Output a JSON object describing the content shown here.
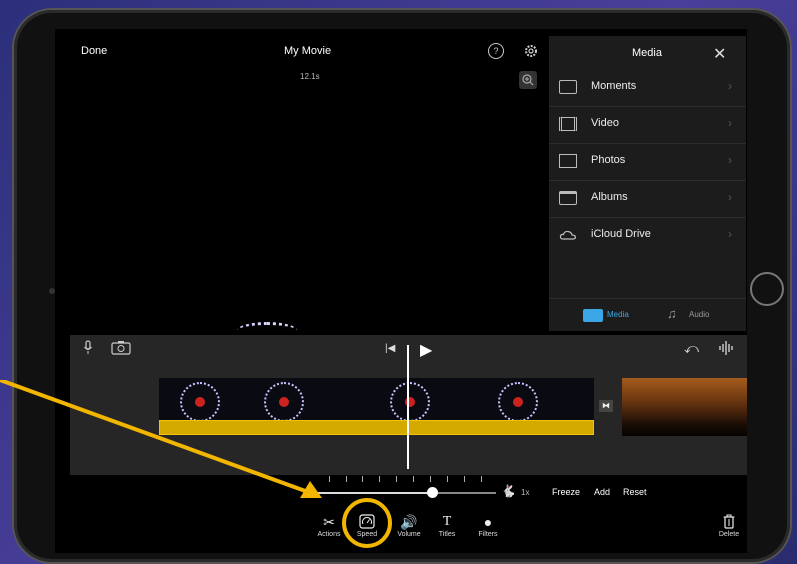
{
  "header": {
    "done_label": "Done",
    "title": "My Movie",
    "duration": "12.1s"
  },
  "icons": {
    "help": "help-icon",
    "settings": "gear-icon",
    "zoom": "zoom-in-icon"
  },
  "media_panel": {
    "title": "Media",
    "items": [
      {
        "label": "Moments",
        "icon": "moments-icon"
      },
      {
        "label": "Video",
        "icon": "film-icon"
      },
      {
        "label": "Photos",
        "icon": "photo-icon"
      },
      {
        "label": "Albums",
        "icon": "albums-icon"
      },
      {
        "label": "iCloud Drive",
        "icon": "cloud-icon"
      }
    ],
    "tabs": [
      {
        "label": "Media",
        "active": true
      },
      {
        "label": "Audio",
        "active": false
      }
    ]
  },
  "speed_controls": {
    "rate": "1x",
    "freeze": "Freeze",
    "add": "Add",
    "reset": "Reset",
    "level_fraction": 0.64
  },
  "toolbar": {
    "actions": "Actions",
    "speed": "Speed",
    "volume": "Volume",
    "titles": "Titles",
    "filters": "Filters",
    "delete": "Delete"
  },
  "colors": {
    "accent_yellow": "#f2b600",
    "clip_bar": "#d4aa00",
    "tab_active": "#3ba6e6"
  }
}
